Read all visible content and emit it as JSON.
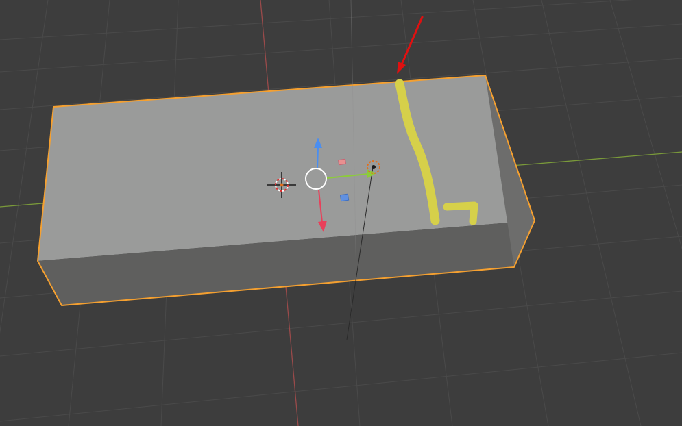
{
  "viewport": {
    "background_color": "#3d3d3d",
    "grid_color": "#4a4a4a",
    "axis_x_color": "#7a9a3a",
    "axis_y_color": "#9a4a4a"
  },
  "object": {
    "name": "cube",
    "selected": true,
    "outline_color": "#f5a030",
    "top_face_color": "#9a9b9a",
    "front_face_color": "#5f5f5e",
    "side_face_color": "#6d6d6c"
  },
  "annotations": {
    "arrow_color": "#e01010",
    "scribble_color": "#d6d04a"
  },
  "gizmo": {
    "z_axis_color": "#4a8ef0",
    "x_axis_color": "#e8405a",
    "y_axis_color": "#8ccc3a"
  },
  "icons": {
    "cursor": "3d-cursor-icon",
    "origin": "object-origin-icon",
    "gizmo": "transform-gizmo-icon",
    "light": "light-icon"
  }
}
